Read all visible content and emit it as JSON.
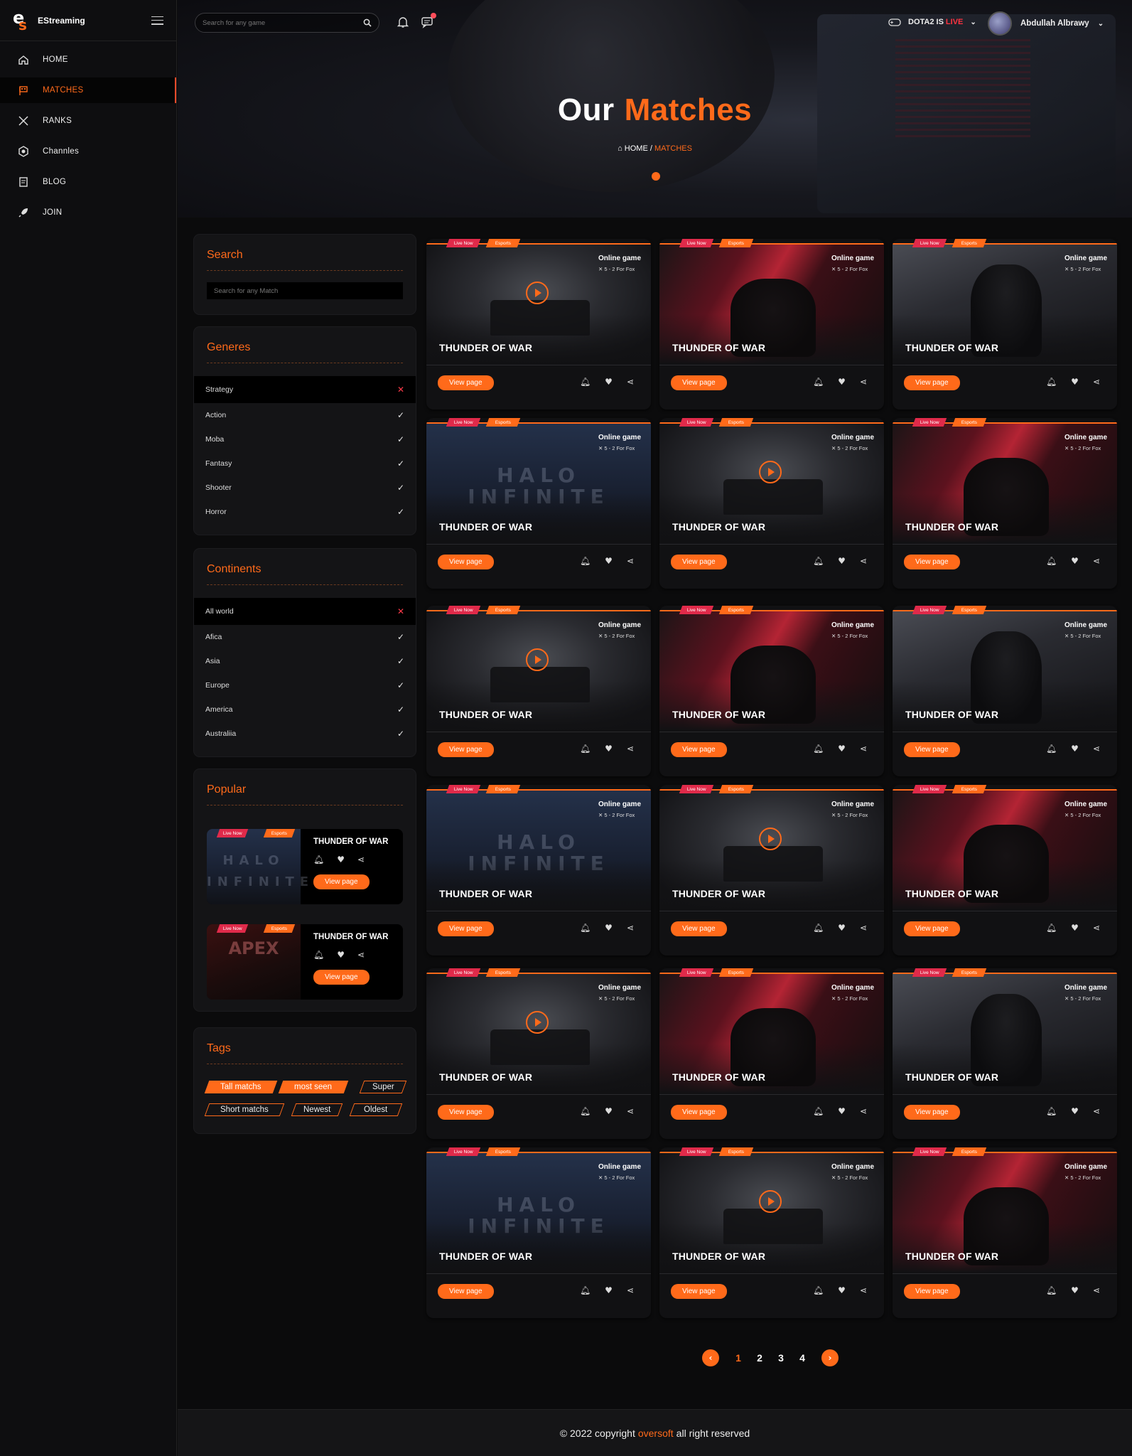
{
  "app": {
    "name": "EStreaming",
    "logo_letters": "es"
  },
  "nav": [
    {
      "label": "HOME",
      "icon": "home-icon"
    },
    {
      "label": "MATCHES",
      "icon": "flag-icon",
      "active": true
    },
    {
      "label": "RANKS",
      "icon": "swords-icon"
    },
    {
      "label": "Channles",
      "icon": "channels-icon"
    },
    {
      "label": "BLOG",
      "icon": "blog-icon"
    },
    {
      "label": "JOIN",
      "icon": "rocket-icon"
    }
  ],
  "topbar": {
    "search_placeholder": "Search for any game",
    "live_game": "DOTA2 IS",
    "live_word": "LIVE",
    "user_name": "Abdullah Albrawy"
  },
  "hero": {
    "title_1": "Our",
    "title_2": "Matches",
    "crumb_home": "HOME /",
    "crumb_current": "MATCHES"
  },
  "search_panel": {
    "title": "Search",
    "placeholder": "Search for any Match"
  },
  "genres": {
    "title": "Generes",
    "selected": "Strategy",
    "items": [
      "Action",
      "Moba",
      "Fantasy",
      "Shooter",
      "Horror"
    ]
  },
  "continents": {
    "title": "Continents",
    "selected": "All world",
    "items": [
      "Afica",
      "Asia",
      "Europe",
      "America",
      "Australiia"
    ]
  },
  "popular": {
    "title": "Popular",
    "items": [
      {
        "name": "THUNDER OF WAR",
        "button": "View page",
        "live": "Live Now",
        "esports": "Esports",
        "art_text": "HALO INFINITE"
      },
      {
        "name": "THUNDER OF WAR",
        "button": "View page",
        "live": "Live Now",
        "esports": "Esports",
        "art_text": "APEX"
      }
    ]
  },
  "tags": {
    "title": "Tags",
    "items": [
      {
        "label": "Tall matchs",
        "style": "filled"
      },
      {
        "label": "most seen",
        "style": "filled"
      },
      {
        "label": "Super",
        "style": "outline"
      },
      {
        "label": "Short matchs",
        "style": "outline"
      },
      {
        "label": "Newest",
        "style": "outline"
      },
      {
        "label": "Oldest",
        "style": "outline"
      }
    ]
  },
  "card_text": {
    "title": "THUNDER OF WAR",
    "online": "Online game",
    "score": "5 - 2  For Fox",
    "button": "View page",
    "live": "Live Now",
    "esports": "Esports",
    "halo_art": "HALO INFINITE"
  },
  "cards": [
    {
      "art": "war"
    },
    {
      "art": "red"
    },
    {
      "art": "apexg"
    },
    {
      "art": "halo"
    },
    {
      "art": "war"
    },
    {
      "art": "red"
    },
    {
      "art": "war"
    },
    {
      "art": "red"
    },
    {
      "art": "apexg"
    },
    {
      "art": "halo"
    },
    {
      "art": "war"
    },
    {
      "art": "red"
    },
    {
      "art": "war"
    },
    {
      "art": "red"
    },
    {
      "art": "apexg"
    },
    {
      "art": "halo"
    },
    {
      "art": "war"
    },
    {
      "art": "red"
    }
  ],
  "pagination": {
    "pages": [
      "1",
      "2",
      "3",
      "4"
    ],
    "current": "1",
    "prev": "‹",
    "next": "›"
  },
  "footer": {
    "before": "© 2022 copyright",
    "brand": "oversoft",
    "after": "all right reserved"
  },
  "colors": {
    "accent": "#ff6a1a",
    "live": "#e02a4a",
    "background": "#0b0b0c"
  }
}
